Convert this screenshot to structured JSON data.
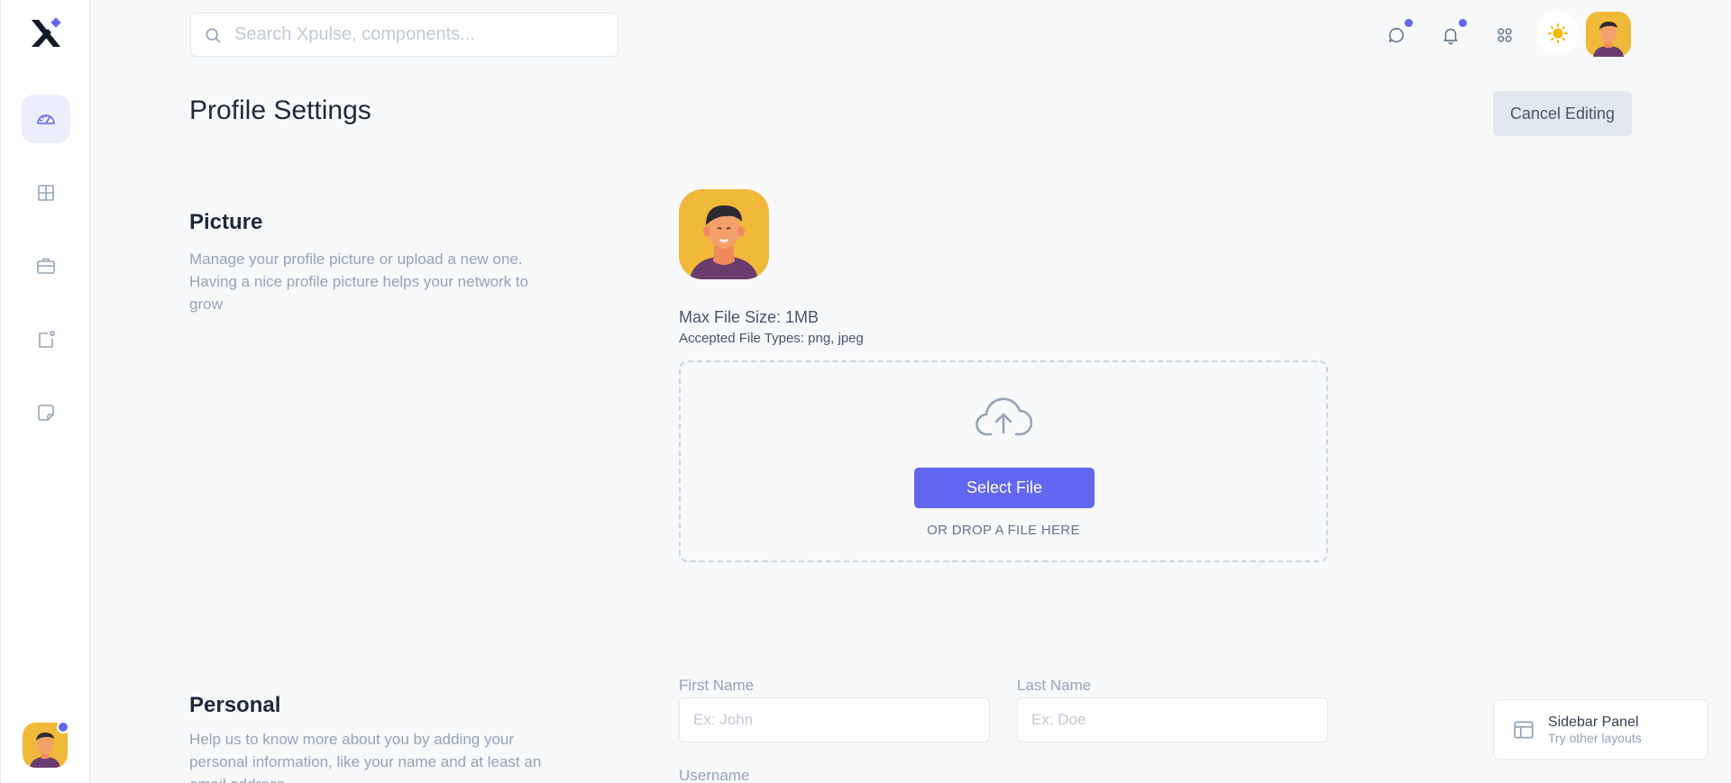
{
  "search": {
    "placeholder": "Search Xpulse, components..."
  },
  "page": {
    "title": "Profile Settings",
    "cancel_label": "Cancel Editing"
  },
  "picture": {
    "title": "Picture",
    "description": "Manage your profile picture or upload a new one. Having a nice profile picture helps your network to grow",
    "max_size": "Max File Size: 1MB",
    "accepted": "Accepted File Types: png, jpeg",
    "select_label": "Select File",
    "drop_text": "OR DROP A FILE HERE"
  },
  "personal": {
    "title": "Personal",
    "description": "Help us to know more about you by adding your personal information, like your name and at least an email address",
    "first_name_label": "First Name",
    "first_name_placeholder": "Ex: John",
    "last_name_label": "Last Name",
    "last_name_placeholder": "Ex: Doe",
    "username_label": "Username"
  },
  "panel_card": {
    "title": "Sidebar Panel",
    "subtitle": "Try other layouts"
  },
  "colors": {
    "accent": "#6366f1",
    "background": "#f8f9fb",
    "avatar_bg": "#f0b93a"
  },
  "icons": {
    "sidebar": [
      "dashboard-icon",
      "grid-icon",
      "briefcase-icon",
      "square-dot-icon",
      "sticky-note-icon"
    ],
    "topbar": [
      "chat-icon",
      "bell-icon",
      "apps-icon",
      "sun-icon"
    ]
  }
}
